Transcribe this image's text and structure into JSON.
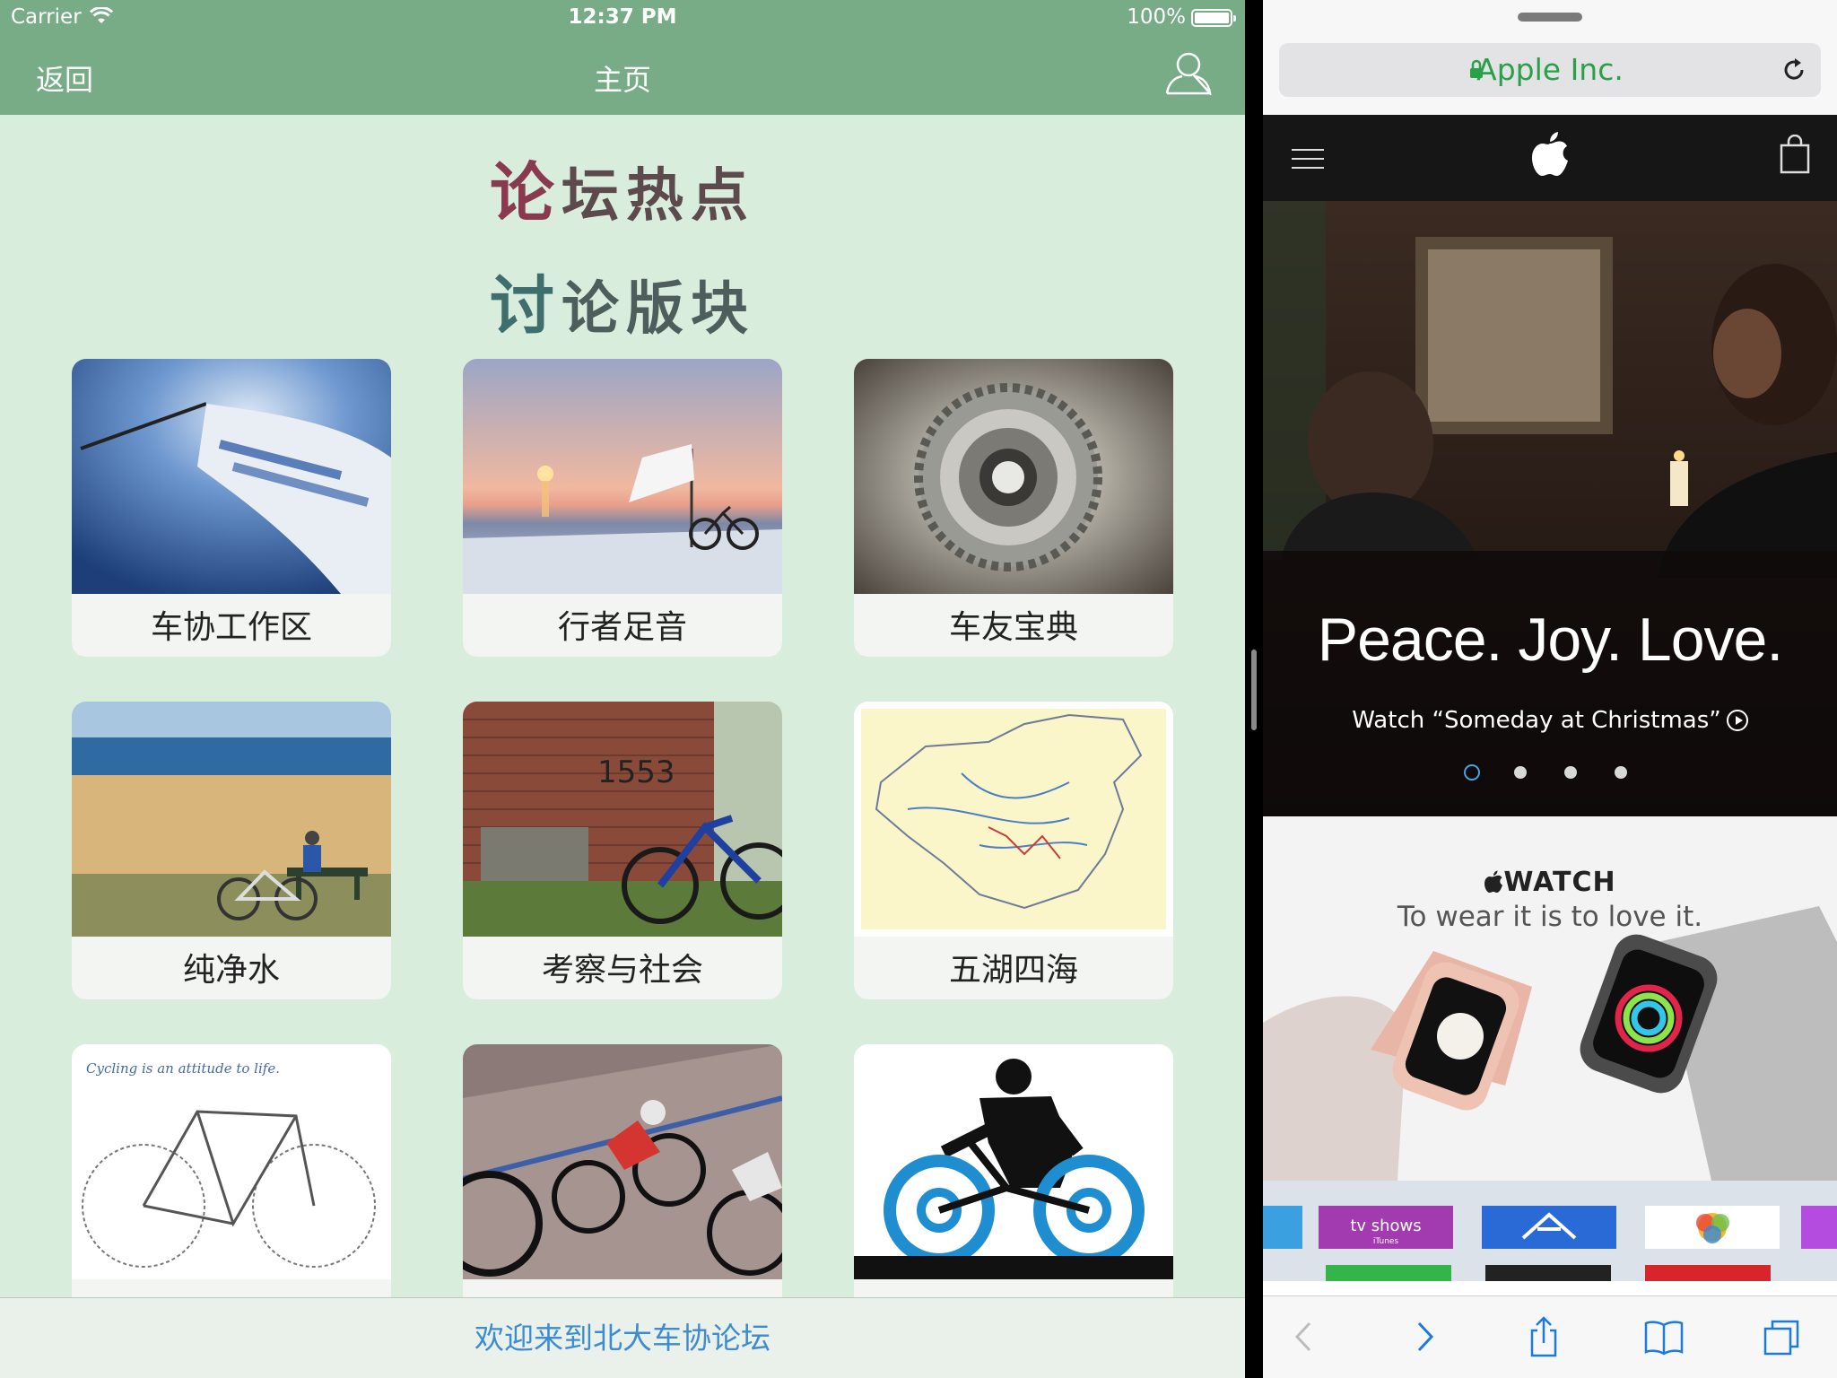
{
  "status": {
    "carrier": "Carrier",
    "time": "12:37 PM",
    "battery": "100%",
    "battery_level": 1.0
  },
  "nav": {
    "back": "返回",
    "title": "主页"
  },
  "headings": {
    "hot_first": "论",
    "hot_rest": "坛热点",
    "board_first": "讨",
    "board_rest": "论版块"
  },
  "boards": [
    {
      "label": "车协工作区"
    },
    {
      "label": "行者足音"
    },
    {
      "label": "车友宝典"
    },
    {
      "label": "纯净水"
    },
    {
      "label": "考察与社会"
    },
    {
      "label": "五湖四海"
    },
    {
      "label": "",
      "image_text": "Cycling is an attitude to life."
    },
    {
      "label": ""
    },
    {
      "label": ""
    }
  ],
  "footer": {
    "text": "欢迎来到北大车协论坛"
  },
  "safari": {
    "host": "Apple Inc.",
    "hero_title": "Peace. Joy. Love.",
    "hero_link": "Watch “Someday at Christmas”",
    "hero_pages": 4,
    "hero_active": 0,
    "watch_brand": "WATCH",
    "watch_tag": "To wear it is to love it.",
    "tv_tile": "tv shows",
    "tv_tile_sub": "iTunes"
  },
  "colors": {
    "nav_green": "#77ac87",
    "page_bg": "#d9eddc",
    "link_blue": "#3d8bd1",
    "safari_green": "#2aa04a"
  }
}
